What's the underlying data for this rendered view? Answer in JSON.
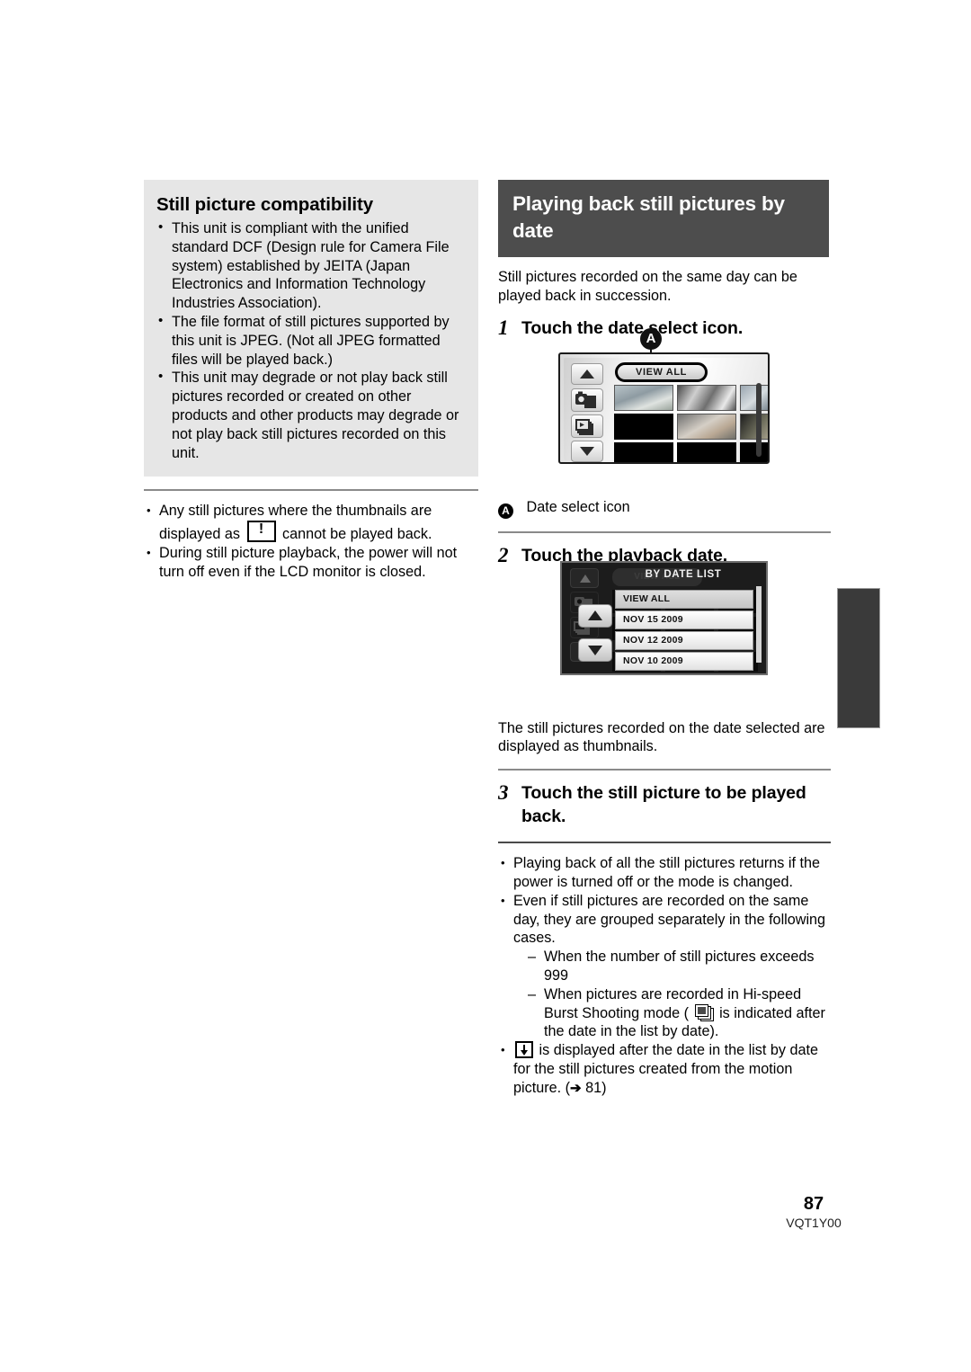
{
  "left_column": {
    "grey_box": {
      "heading": "Still picture compatibility",
      "bullets": [
        "This unit is compliant with the unified standard DCF (Design rule for Camera File system) established by JEITA (Japan Electronics and Information Technology Industries Association).",
        "The file format of still pictures supported by this unit is JPEG. (Not all JPEG formatted files will be played back.)",
        "This unit may degrade or not play back still pictures recorded or created on other products and other products may degrade or not play back still pictures recorded on this unit."
      ]
    },
    "notes": {
      "bullet1_part1": "Any still pictures where the thumbnails are displayed as",
      "bullet1_icon": "warning-thumbnail-icon",
      "bullet1_part2": "cannot be played back.",
      "bullet2": "During still picture playback, the power will not turn off even if the LCD monitor is closed."
    }
  },
  "right_column": {
    "section_title": "Playing back still pictures by date",
    "intro": "Still pictures recorded on the same day can be played back in succession.",
    "steps": [
      {
        "number": "1",
        "text": "Touch the date select icon."
      },
      {
        "number": "2",
        "text": "Touch the playback date."
      },
      {
        "number": "3",
        "text": "Touch the still picture to be played back."
      }
    ],
    "callout": {
      "marker": "A",
      "label": "Date select icon"
    },
    "after_step2_text": "The still pictures recorded on the date selected are displayed as thumbnails.",
    "final_notes": {
      "bullet1": "Playing back of all the still pictures returns if the power is turned off or the mode is changed.",
      "bullet2": "Even if still pictures are recorded on the same day, they are grouped separately in the following cases.",
      "dash1": "When the number of still pictures exceeds 999",
      "dash2_part1": "When pictures are recorded in Hi-speed Burst Shooting mode (",
      "dash2_icon": "burst-shooting-icon",
      "dash2_part2": "is indicated after the date in the list by date).",
      "bullet3_icon": "motion-picture-capture-icon",
      "bullet3_part1": "is displayed after the date in the list by date for the still pictures created from the motion picture. (",
      "bullet3_arrow": "➔",
      "bullet3_ref": "81",
      "bullet3_part2": ")"
    }
  },
  "screenshot_view_all": {
    "button_label": "VIEW ALL",
    "nav_up": "scroll-up-arrow",
    "nav_down": "scroll-down-arrow",
    "icon_photo_mode": "photo-mode-icon",
    "icon_playback_mode": "playback-mode-icon"
  },
  "screenshot_by_date": {
    "title": "BY DATE LIST",
    "ghost_label": "VIEW ALL",
    "rows": [
      {
        "label": "VIEW ALL",
        "selected": true
      },
      {
        "label": "NOV 15 2009",
        "selected": false
      },
      {
        "label": "NOV 12 2009",
        "selected": false
      },
      {
        "label": "NOV 10 2009",
        "selected": false
      }
    ]
  },
  "footer": {
    "page_number": "87",
    "doc_code": "VQT1Y00"
  }
}
